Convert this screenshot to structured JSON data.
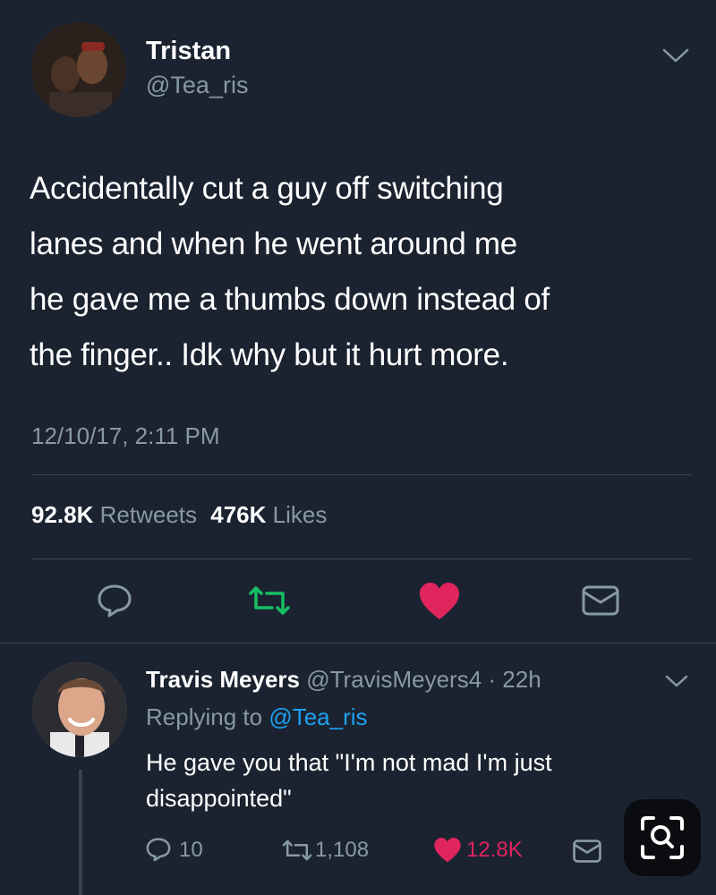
{
  "tweet": {
    "author_name": "Tristan",
    "author_handle": "@Tea_ris",
    "text_lines": [
      "Accidentally cut a guy off switching",
      "lanes and when he went around me",
      "he gave me a thumbs down instead of",
      "the finger.. Idk why but it hurt more."
    ],
    "timestamp": "12/10/17, 2:11 PM",
    "retweets_count": "92.8K",
    "retweets_label": "Retweets",
    "likes_count": "476K",
    "likes_label": "Likes"
  },
  "reply": {
    "author_name": "Travis Meyers",
    "author_handle": "@TravisMeyers4",
    "time": "· 22h",
    "replying_prefix": "Replying to",
    "replying_handle": "@Tea_ris",
    "text_lines": [
      "He gave you that \"I'm not mad I'm just",
      "disappointed\""
    ],
    "reply_count": "10",
    "retweet_count": "1,108",
    "like_count": "12.8K"
  },
  "colors": {
    "background": "#1b2331",
    "muted": "#8899a6",
    "accent": "#1da1f2",
    "retweet": "#17bf63",
    "like": "#e0245e"
  },
  "icons": [
    "chevron-down-icon",
    "reply-icon",
    "retweet-icon",
    "heart-icon",
    "message-icon",
    "lens-search-icon"
  ]
}
